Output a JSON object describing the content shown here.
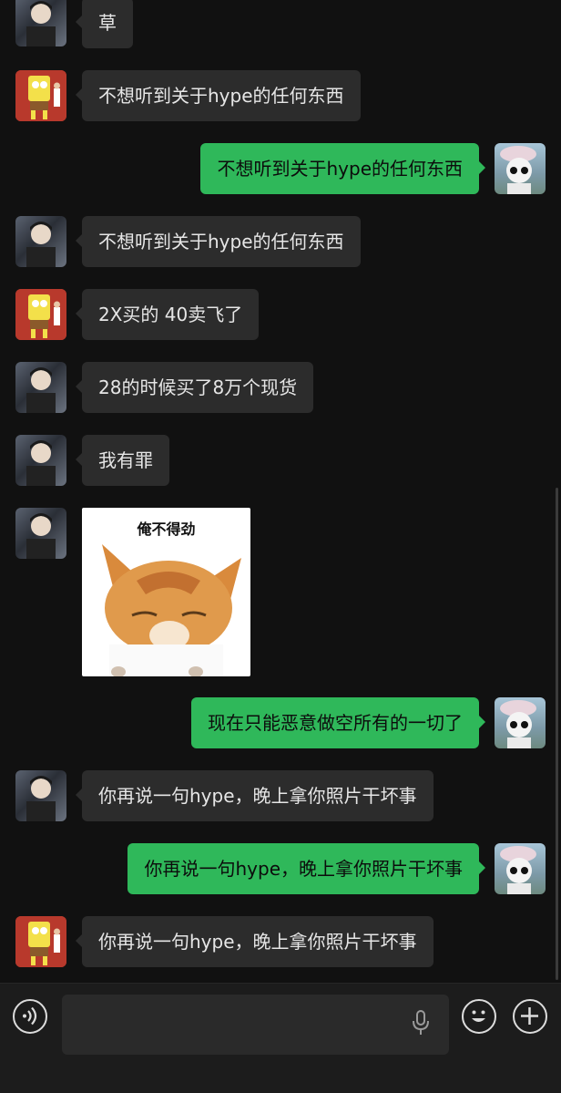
{
  "messages": [
    {
      "side": "left",
      "sender": "boy",
      "text": "草"
    },
    {
      "side": "left",
      "sender": "sponge",
      "text": "不想听到关于hype的任何东西"
    },
    {
      "side": "right",
      "sender": "me",
      "text": "不想听到关于hype的任何东西"
    },
    {
      "side": "left",
      "sender": "boy",
      "text": "不想听到关于hype的任何东西"
    },
    {
      "side": "left",
      "sender": "sponge",
      "text": "2X买的 40卖飞了"
    },
    {
      "side": "left",
      "sender": "boy",
      "text": "28的时候买了8万个现货"
    },
    {
      "side": "left",
      "sender": "boy",
      "text": "我有罪"
    },
    {
      "side": "left",
      "sender": "boy",
      "sticker_caption": "俺不得劲"
    },
    {
      "side": "right",
      "sender": "me",
      "text": "现在只能恶意做空所有的一切了"
    },
    {
      "side": "left",
      "sender": "boy",
      "text": "你再说一句hype，晚上拿你照片干坏事"
    },
    {
      "side": "right",
      "sender": "me",
      "text": "你再说一句hype，晚上拿你照片干坏事"
    },
    {
      "side": "left",
      "sender": "sponge",
      "text": "你再说一句hype，晚上拿你照片干坏事"
    }
  ],
  "input_bar": {
    "icons": [
      "voice-icon",
      "microphone-icon",
      "emoji-icon",
      "plus-icon"
    ]
  },
  "colors": {
    "background": "#111111",
    "incoming_bubble": "#2c2c2c",
    "outgoing_bubble": "#2fb85a"
  }
}
